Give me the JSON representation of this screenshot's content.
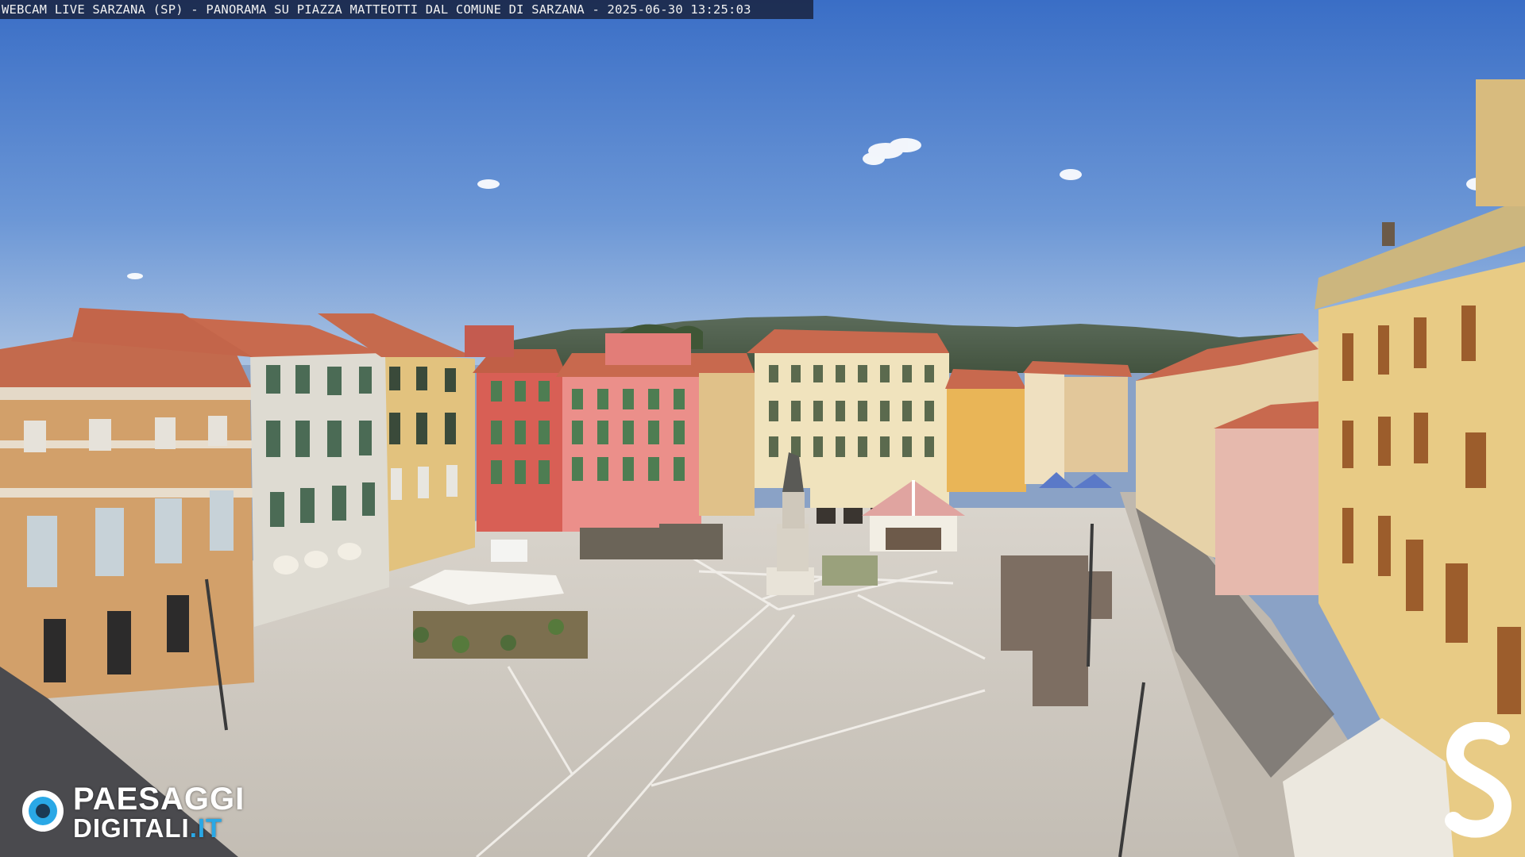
{
  "overlay": {
    "caption": "WEBCAM LIVE SARZANA (SP) - PANORAMA SU PIAZZA MATTEOTTI DAL COMUNE DI SARZANA - 2025-06-30  13:25:03"
  },
  "watermark_logo": {
    "line1": "PAESAGGI",
    "line2_main": "DIGITALI",
    "line2_tld": ".IT",
    "icon": "eye-icon"
  },
  "corner_logo": {
    "icon": "s-monogram-icon"
  },
  "colors": {
    "sky_top": "#3d73c9",
    "sky_bottom": "#9cb8dc",
    "pavement": "#cfcac2",
    "terracotta_roof": "#c8674a",
    "accent_blue": "#2aa8e6"
  }
}
